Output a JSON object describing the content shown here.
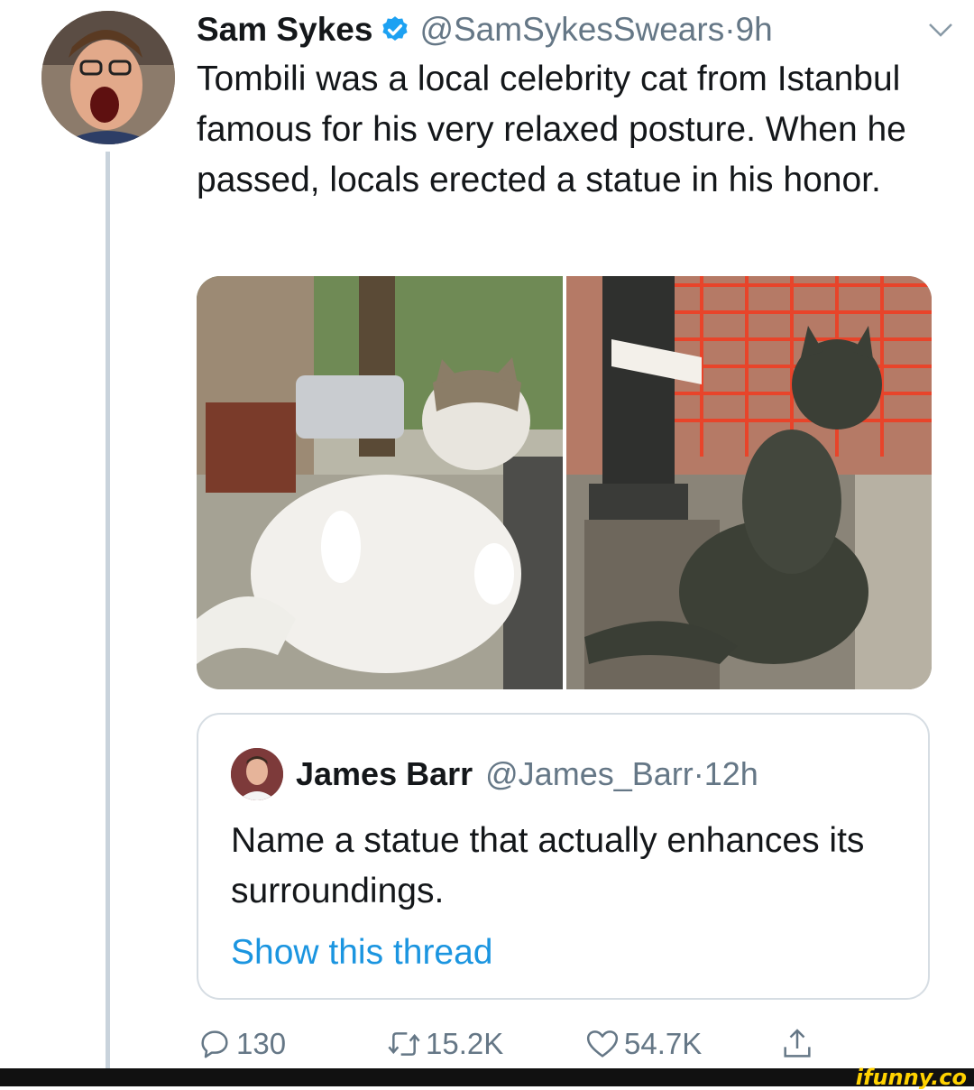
{
  "tweet": {
    "author_name": "Sam Sykes",
    "handle": "@SamSykesSwears",
    "separator": " · ",
    "time": "9h",
    "text": "Tombili was a local celebrity cat from Istanbul famous for his very relaxed posture. When he passed, locals erected a statue in his honor.",
    "icons": {
      "verified": "verified-badge-icon",
      "menu": "chevron-down-icon"
    }
  },
  "quoted_tweet": {
    "author_name": "James Barr",
    "handle": "@James_Barr",
    "separator": " · ",
    "time": "12h",
    "text": "Name a statue that actually enhances its surroundings.",
    "link": "Show this thread"
  },
  "actions": {
    "replies": "130",
    "retweets": "15.2K",
    "likes": "54.7K",
    "icons": [
      "reply-icon",
      "retweet-icon",
      "like-icon",
      "share-icon"
    ]
  },
  "watermark": "ifunny.co",
  "colors": {
    "link": "#1b95e0",
    "secondary": "#657786",
    "verified": "#1da1f2"
  }
}
